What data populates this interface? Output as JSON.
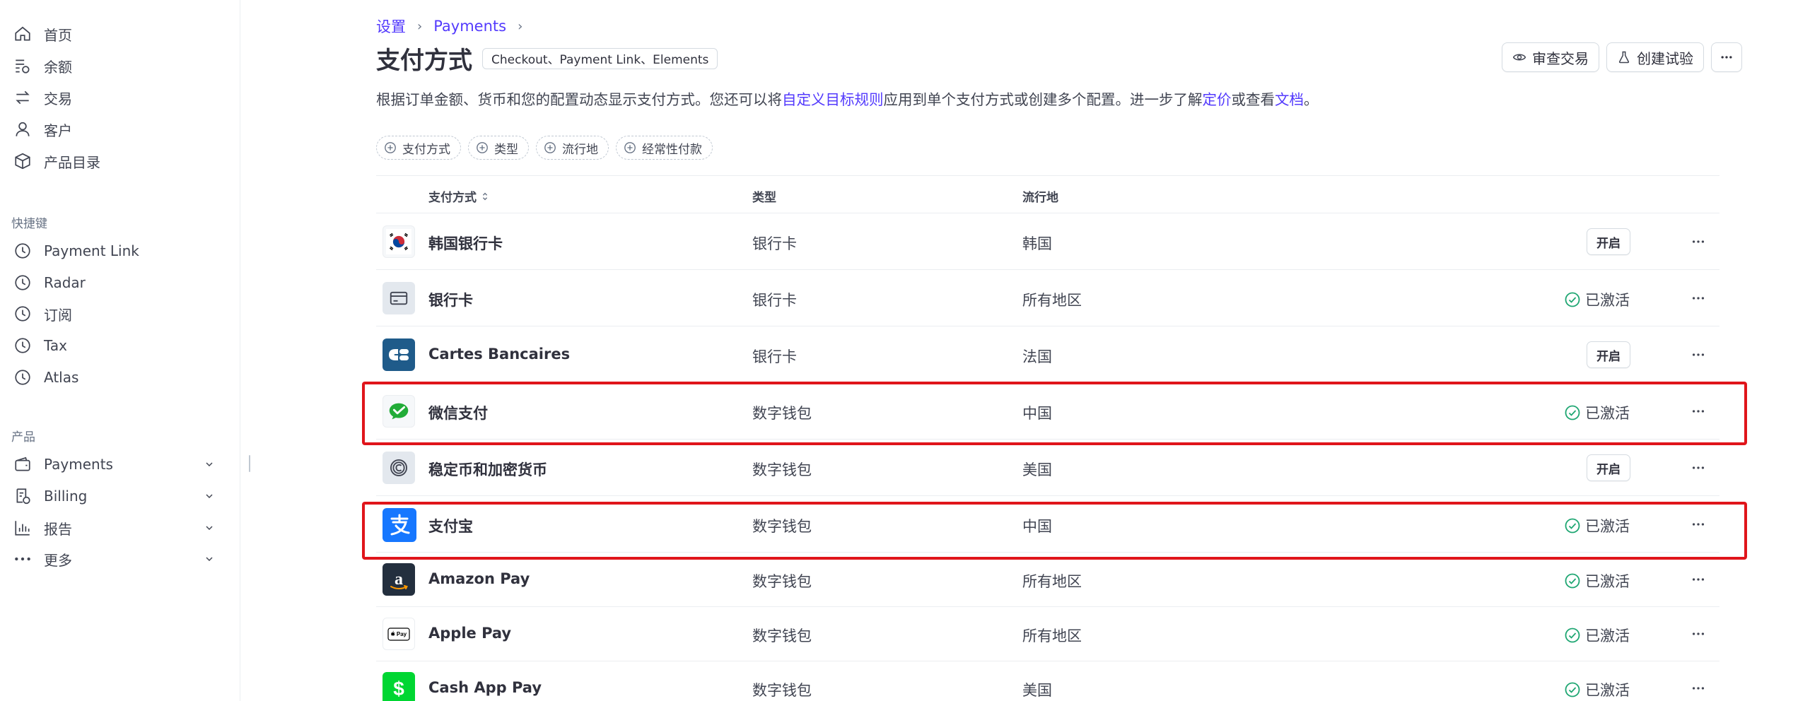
{
  "sidebar": {
    "main_items": [
      {
        "label": "首页",
        "icon": "home-icon"
      },
      {
        "label": "余额",
        "icon": "balance-icon"
      },
      {
        "label": "交易",
        "icon": "transactions-icon"
      },
      {
        "label": "客户",
        "icon": "customer-icon"
      },
      {
        "label": "产品目录",
        "icon": "product-catalog-icon"
      }
    ],
    "shortcuts_label": "快捷键",
    "shortcuts": [
      {
        "label": "Payment Link",
        "icon": "clock-icon"
      },
      {
        "label": "Radar",
        "icon": "clock-icon"
      },
      {
        "label": "订阅",
        "icon": "clock-icon"
      },
      {
        "label": "Tax",
        "icon": "clock-icon"
      },
      {
        "label": "Atlas",
        "icon": "clock-icon"
      }
    ],
    "products_label": "产品",
    "products": [
      {
        "label": "Payments",
        "icon": "wallet-icon"
      },
      {
        "label": "Billing",
        "icon": "billing-icon"
      },
      {
        "label": "报告",
        "icon": "reports-icon"
      },
      {
        "label": "更多",
        "icon": "more-dots-icon"
      }
    ]
  },
  "breadcrumb": {
    "items": [
      "设置",
      "Payments"
    ]
  },
  "header": {
    "title": "支付方式",
    "badge": "Checkout、Payment Link、Elements",
    "actions": {
      "review": "审查交易",
      "experiment": "创建试验"
    }
  },
  "description": {
    "part1": "根据订单金额、货币和您的配置动态显示支付方式。您还可以将",
    "link1": "自定义目标规则",
    "part2": "应用到单个支付方式或创建多个配置。进一步了解",
    "link2": "定价",
    "part3": "或查看",
    "link3": "文档",
    "part4": "。"
  },
  "filters": [
    "支付方式",
    "类型",
    "流行地",
    "经常性付款"
  ],
  "table": {
    "headers": {
      "method": "支付方式",
      "type": "类型",
      "region": "流行地"
    },
    "enable_label": "开启",
    "active_label": "已激活",
    "rows": [
      {
        "name": "韩国银行卡",
        "type": "银行卡",
        "region": "韩国",
        "status": "enable",
        "logo": "korea-flag-icon"
      },
      {
        "name": "银行卡",
        "type": "银行卡",
        "region": "所有地区",
        "status": "active",
        "logo": "card-icon"
      },
      {
        "name": "Cartes Bancaires",
        "type": "银行卡",
        "region": "法国",
        "status": "enable",
        "logo": "cartes-bancaires-logo"
      },
      {
        "name": "微信支付",
        "type": "数字钱包",
        "region": "中国",
        "status": "active",
        "logo": "wechat-pay-logo"
      },
      {
        "name": "稳定币和加密货币",
        "type": "数字钱包",
        "region": "美国",
        "status": "enable",
        "logo": "crypto-icon"
      },
      {
        "name": "支付宝",
        "type": "数字钱包",
        "region": "中国",
        "status": "active",
        "logo": "alipay-logo"
      },
      {
        "name": "Amazon Pay",
        "type": "数字钱包",
        "region": "所有地区",
        "status": "active",
        "logo": "amazon-pay-logo"
      },
      {
        "name": "Apple Pay",
        "type": "数字钱包",
        "region": "所有地区",
        "status": "active",
        "logo": "apple-pay-logo"
      },
      {
        "name": "Cash App Pay",
        "type": "数字钱包",
        "region": "美国",
        "status": "active",
        "logo": "cash-app-logo"
      }
    ]
  },
  "colors": {
    "accent": "#533afd",
    "highlight": "#e0151b",
    "success": "#1ea672",
    "text": "#30313d"
  }
}
